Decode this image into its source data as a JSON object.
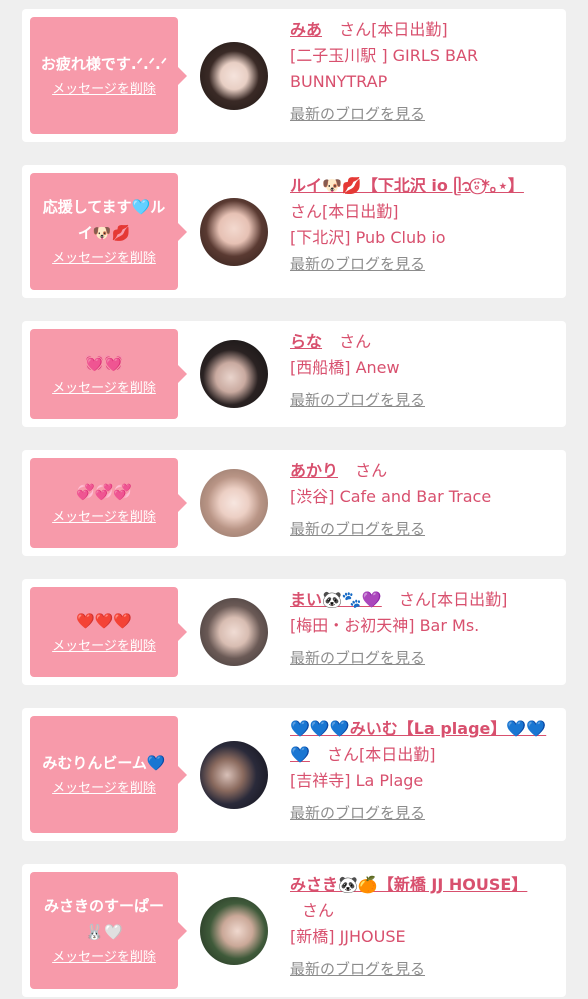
{
  "entries": [
    {
      "message": "お疲れ様です.ᐟ‪.ᐟ‪‪.ᐟ‪",
      "delete_label": "メッセージを削除",
      "name": "みあ",
      "san": "さん",
      "working": "[本日出勤]",
      "store": "[二子玉川駅 ] GIRLS BAR BUNNYTRAP",
      "blog_label": "最新のブログを見る"
    },
    {
      "message": "応援してます🩵ルイ🐶💋",
      "delete_label": "メッセージを削除",
      "name": "ルイ🐶💋【下北沢 io ᥫ᭡⍤⃝*｡⋆】",
      "san": "さん",
      "working": "[本日出勤]",
      "store": "[下北沢] Pub Club io",
      "blog_label": "最新のブログを見る"
    },
    {
      "message": "💓💓",
      "delete_label": "メッセージを削除",
      "name": "らな",
      "san": "さん",
      "working": "",
      "store": "[西船橋] Anew",
      "blog_label": "最新のブログを見る"
    },
    {
      "message": "💞💞💞",
      "delete_label": "メッセージを削除",
      "name": "あかり",
      "san": "さん",
      "working": "",
      "store": "[渋谷] Cafe and Bar Trace",
      "blog_label": "最新のブログを見る"
    },
    {
      "message": "❤️❤️❤️",
      "delete_label": "メッセージを削除",
      "name": "まい🐼🐾💜",
      "san": "さん",
      "working": "[本日出勤]",
      "store": "[梅田・お初天神] Bar Ms.",
      "blog_label": "最新のブログを見る"
    },
    {
      "message": "みむりんビーム💙",
      "delete_label": "メッセージを削除",
      "name": "💙💙💙みいむ【La plage】💙💙💙",
      "san": "さん",
      "working": "[本日出勤]",
      "store": "[吉祥寺] La Plage",
      "blog_label": "最新のブログを見る"
    },
    {
      "message": "みさきのすーぱー🐰🤍",
      "delete_label": "メッセージを削除",
      "name": "みさき🐼🍊【新橋 JJ HOUSE】",
      "san": "さん",
      "working": "",
      "store": "[新橋] JJHOUSE",
      "blog_label": "最新のブログを見る"
    }
  ],
  "colors": {
    "accent": "#d8506e",
    "bubble": "#f79aaa",
    "link_gray": "#8c8c8c",
    "background": "#efefef"
  }
}
